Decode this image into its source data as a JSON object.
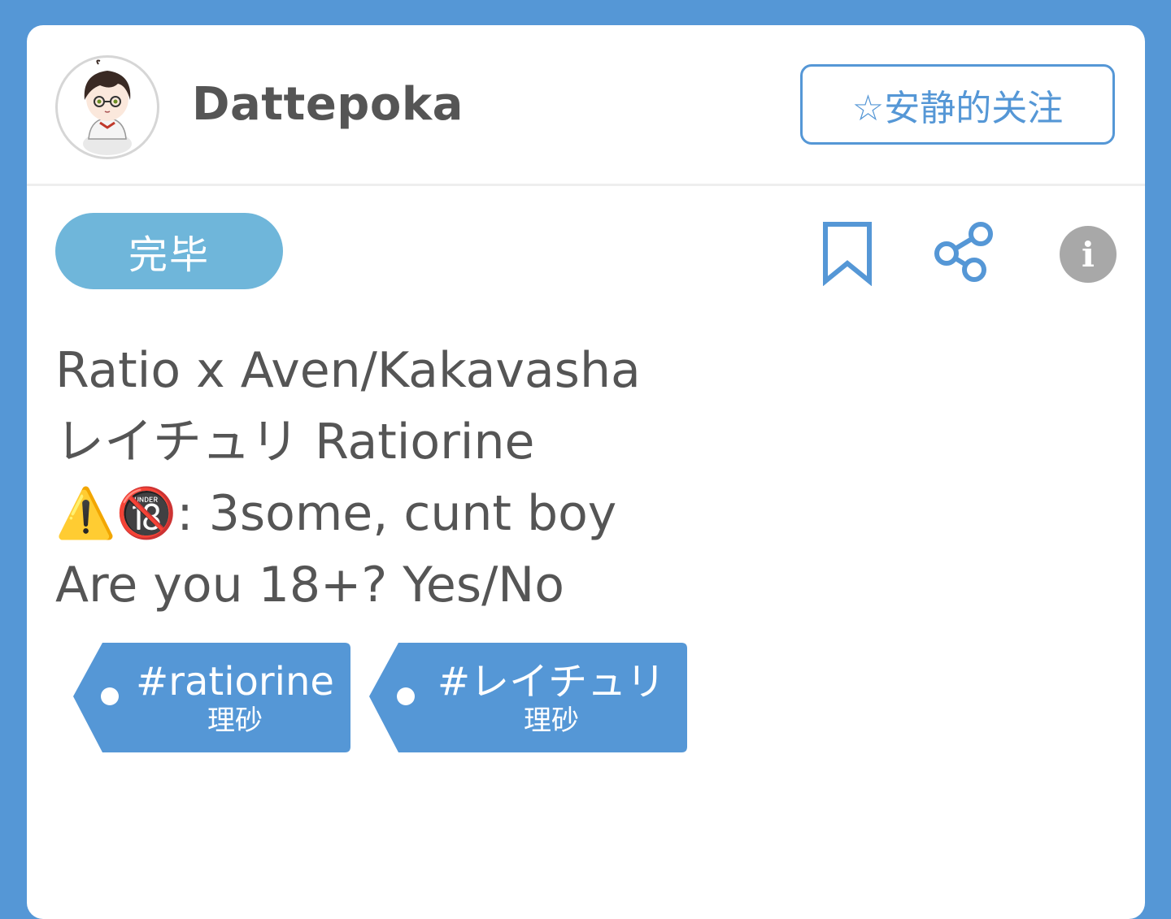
{
  "user": {
    "name": "Dattepoka"
  },
  "follow_button": {
    "label": "☆安静的关注"
  },
  "status": {
    "label": "完毕"
  },
  "actions": {
    "bookmark_icon": "bookmark-icon",
    "share_icon": "share-icon",
    "info_icon": "info-icon",
    "info_glyph": "i"
  },
  "description": {
    "lines": [
      "Ratio x Aven/Kakavasha",
      "レイチュリ Ratiorine",
      "⚠️🔞: 3some, cunt boy",
      "Are you 18+? Yes/No"
    ]
  },
  "tags": [
    {
      "label": "#ratiorine",
      "sub": "理砂"
    },
    {
      "label": "#レイチュリ",
      "sub": "理砂"
    }
  ],
  "colors": {
    "background": "#5597d6",
    "accent": "#5597d6",
    "status_pill": "#6fb6da",
    "text": "#555555"
  }
}
